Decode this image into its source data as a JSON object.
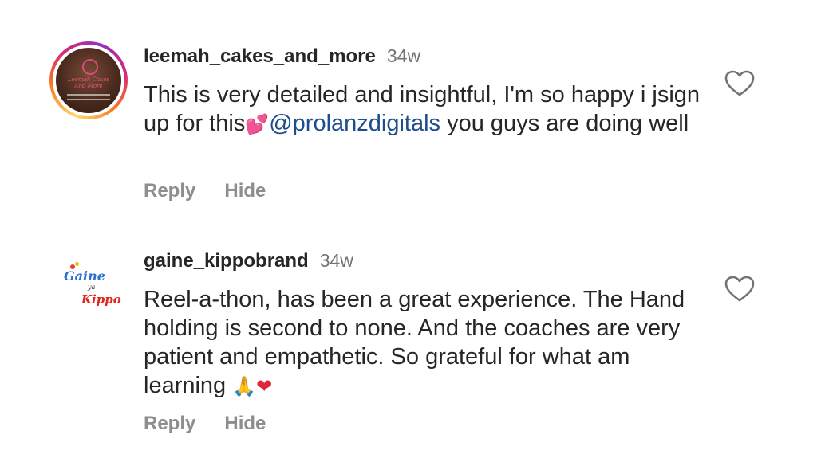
{
  "comments": [
    {
      "username": "leemah_cakes_and_more",
      "time": "34w",
      "text_before": "This is very detailed and insightful, I'm so happy i jsign up for this",
      "emoji": "💕",
      "mention": "@prolanzdigitals",
      "text_after": " you guys are doing well",
      "reply_label": "Reply",
      "hide_label": "Hide",
      "avatar_text": "Leemah Cakes And More"
    },
    {
      "username": "gaine_kippobrand",
      "time": "34w",
      "text": "Reel-a-thon, has been a great experience. The Hand holding is second to none. And the coaches are very patient and empathetic. So grateful for what am learning ",
      "emoji_pray": "🙏",
      "emoji_heart": "❤",
      "reply_label": "Reply",
      "hide_label": "Hide",
      "avatar_brand_top": "Gaine",
      "avatar_brand_mid": "ya",
      "avatar_brand_bottom": "Kippo"
    }
  ],
  "icons": {
    "like": "heart-outline-icon"
  },
  "colors": {
    "text": "#262626",
    "muted": "#737373",
    "actions": "#8e8e8e",
    "mention": "#1e4d8c"
  }
}
